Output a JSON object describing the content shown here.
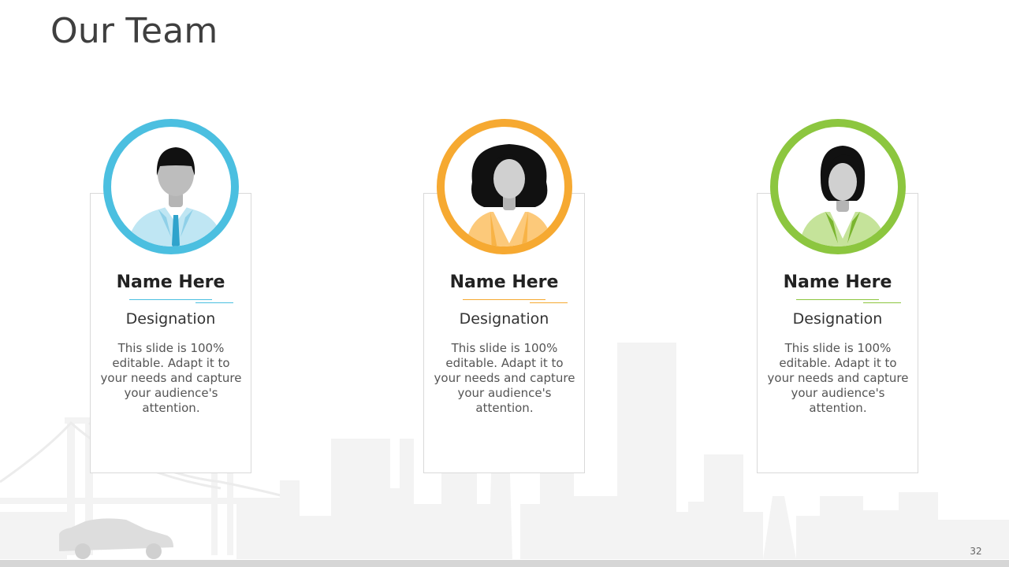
{
  "slide": {
    "title": "Our Team",
    "page_number": "32"
  },
  "team": [
    {
      "name": "Name Here",
      "designation": "Designation",
      "description": "This slide is 100% editable. Adapt it to your needs and capture your audience's attention.",
      "accent_color": "#4bbfe0",
      "icon": "businessman-icon"
    },
    {
      "name": "Name Here",
      "designation": "Designation",
      "description": "This slide is 100% editable. Adapt it to your needs and capture your audience's attention.",
      "accent_color": "#f6a931",
      "icon": "businesswoman-icon"
    },
    {
      "name": "Name Here",
      "designation": "Designation",
      "description": "This slide is 100% editable. Adapt it to your needs and capture your audience's attention.",
      "accent_color": "#8cc63f",
      "icon": "businesswoman-icon"
    }
  ],
  "background": {
    "skyline_color": "#f2f2f2",
    "bar_color": "#d6d6d6",
    "decorations": [
      "city-skyline-icon",
      "bridge-icon",
      "car-icon"
    ]
  }
}
